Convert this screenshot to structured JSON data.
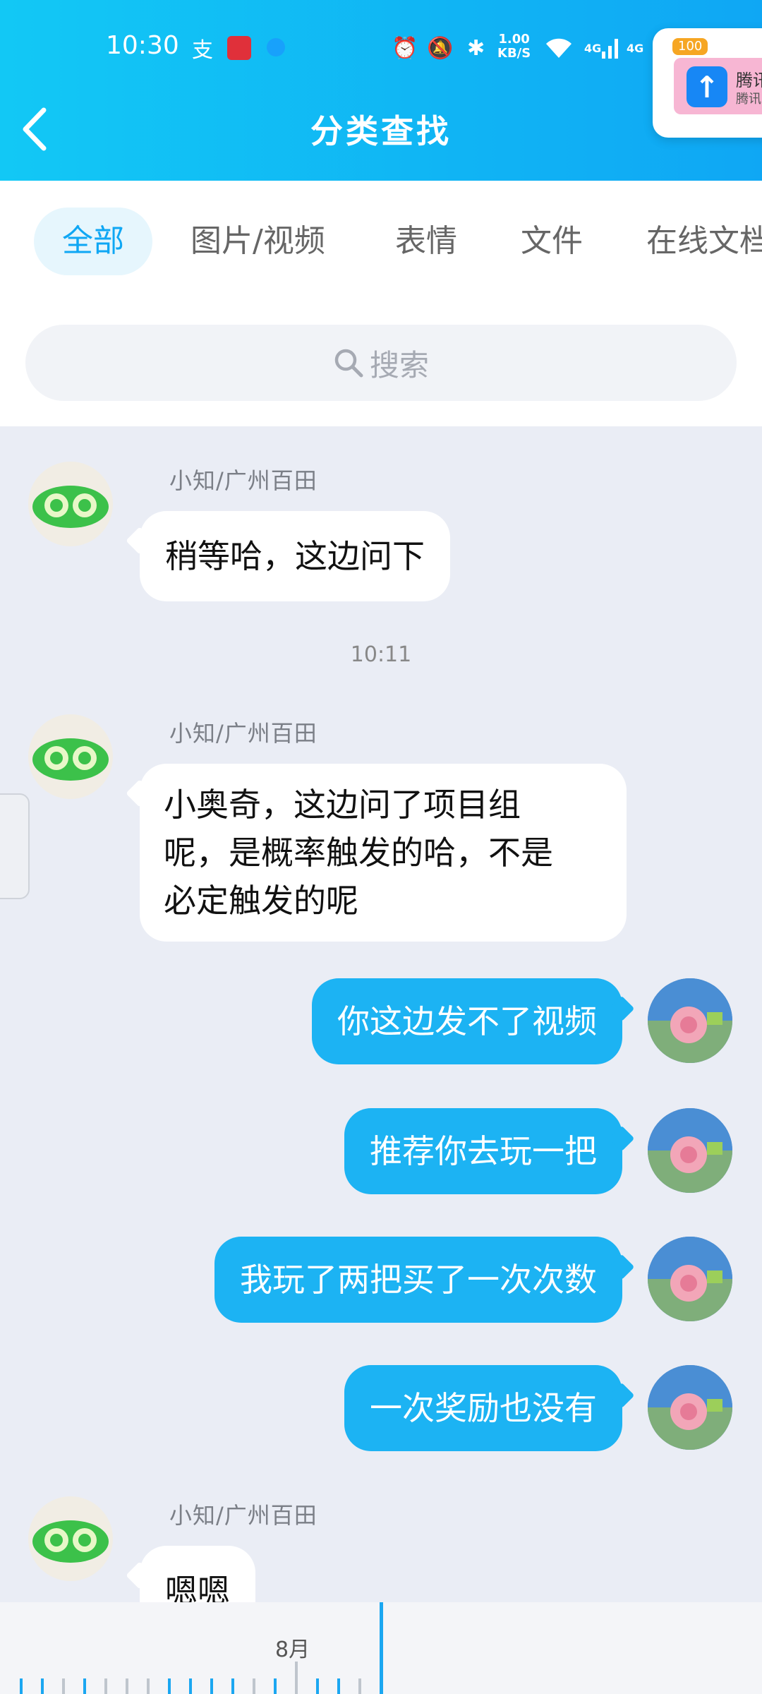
{
  "status_bar": {
    "time": "10:30",
    "speed_value": "1.00",
    "speed_unit": "KB/S",
    "net_1": "4G",
    "net_2": "4G"
  },
  "header": {
    "title": "分类查找"
  },
  "float_widget": {
    "badge": "100",
    "title": "腾讯",
    "subtitle": "腾讯"
  },
  "tabs": [
    {
      "label": "全部",
      "active": true
    },
    {
      "label": "图片/视频",
      "active": false
    },
    {
      "label": "表情",
      "active": false
    },
    {
      "label": "文件",
      "active": false
    },
    {
      "label": "在线文档",
      "active": false
    }
  ],
  "search": {
    "placeholder": "搜索"
  },
  "messages": [
    {
      "side": "left",
      "sender": "小知/广州百田",
      "text": "稍等哈，这边问下"
    },
    {
      "type": "time",
      "text": "10:11"
    },
    {
      "side": "left",
      "sender": "小知/广州百田",
      "lines": [
        "小奥奇，这边问了项目组",
        "呢，是概率触发的哈，不是",
        "必定触发的呢"
      ]
    },
    {
      "side": "right",
      "text": "你这边发不了视频"
    },
    {
      "side": "right",
      "text": "推荐你去玩一把"
    },
    {
      "side": "right",
      "text": "我玩了两把买了一次次数"
    },
    {
      "side": "right",
      "text": "一次奖励也没有"
    },
    {
      "side": "left",
      "sender": "小知/广州百田",
      "text": "嗯嗯"
    }
  ],
  "timeline": {
    "month_label": "8月"
  },
  "colors": {
    "accent": "#0fa7f4",
    "bubble_right": "#1cb3f3",
    "chat_bg": "#eaedf5"
  }
}
